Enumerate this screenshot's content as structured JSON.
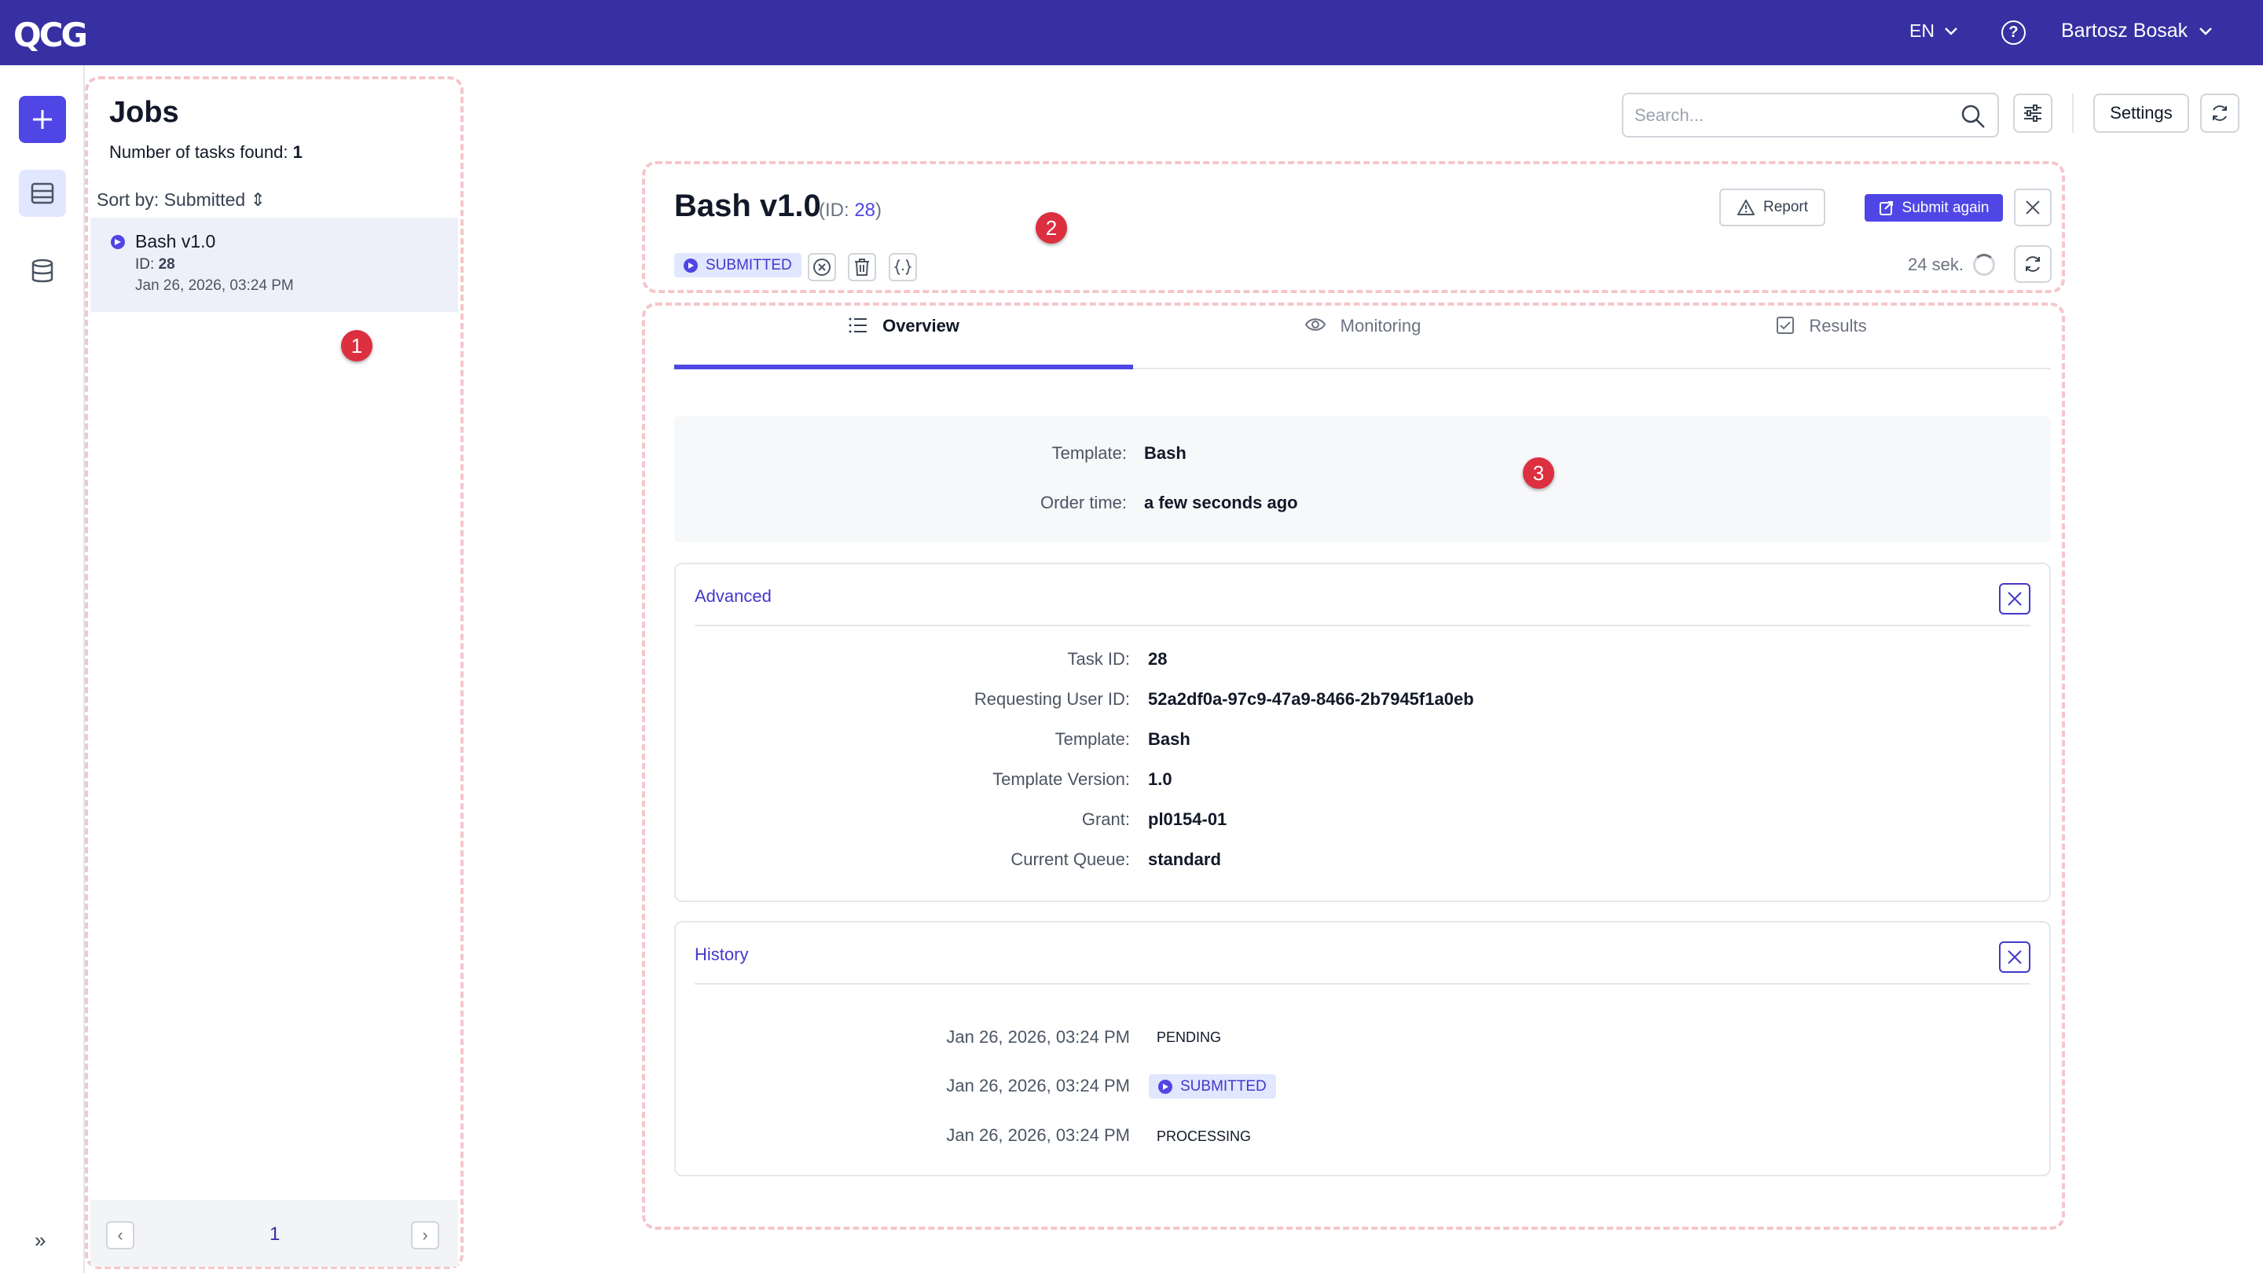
{
  "topbar": {
    "logo": "QCG",
    "language": "EN",
    "help": "?",
    "user_name": "Bartosz Bosak"
  },
  "sidebar": {
    "items": [
      {
        "name": "new-job",
        "icon": "plus-icon"
      },
      {
        "name": "jobs",
        "icon": "list-icon",
        "active": true
      },
      {
        "name": "storage",
        "icon": "database-icon"
      }
    ],
    "expand": "»"
  },
  "jobs": {
    "title": "Jobs",
    "count_label": "Number of tasks found:",
    "count": "1",
    "sort": "Sort by: Submitted ⇕",
    "items": [
      {
        "name": "Bash v1.0",
        "id_label": "ID:",
        "id": "28",
        "date": "Jan 26, 2026, 03:24 PM",
        "status": "submitted"
      }
    ],
    "pagination": {
      "prev": "‹",
      "page": "1",
      "next": "›"
    }
  },
  "toolbar": {
    "search_placeholder": "Search...",
    "settings": "Settings"
  },
  "task": {
    "title": "Bash v1.0",
    "id_prefix": "(ID: ",
    "id": "28",
    "id_suffix": ")",
    "status": "SUBMITTED",
    "report": "Report",
    "submit_again": "Submit again",
    "timer": "24 sek."
  },
  "tabs": [
    {
      "label": "Overview",
      "icon": "list-icon",
      "active": true
    },
    {
      "label": "Monitoring",
      "icon": "eye-icon"
    },
    {
      "label": "Results",
      "icon": "checkbox-icon"
    }
  ],
  "overview": [
    {
      "key": "Template:",
      "value": "Bash"
    },
    {
      "key": "Order time:",
      "value": "a few seconds ago"
    }
  ],
  "advanced": {
    "title": "Advanced",
    "rows": [
      {
        "key": "Task ID:",
        "value": "28"
      },
      {
        "key": "Requesting User ID:",
        "value": "52a2df0a-97c9-47a9-8466-2b7945f1a0eb"
      },
      {
        "key": "Template:",
        "value": "Bash"
      },
      {
        "key": "Template Version:",
        "value": "1.0"
      },
      {
        "key": "Grant:",
        "value": "pl0154-01"
      },
      {
        "key": "Current Queue:",
        "value": "standard"
      }
    ]
  },
  "history": {
    "title": "History",
    "rows": [
      {
        "date": "Jan 26, 2026, 03:24 PM",
        "status": "PENDING"
      },
      {
        "date": "Jan 26, 2026, 03:24 PM",
        "status": "SUBMITTED"
      },
      {
        "date": "Jan 26, 2026, 03:24 PM",
        "status": "PROCESSING"
      }
    ]
  },
  "markers": [
    "1",
    "2",
    "3"
  ],
  "colors": {
    "brand": "#3730a3",
    "accent": "#4f46e5",
    "annotation": "#dc2f3f",
    "dashed_outline": "#f5c6cb"
  }
}
